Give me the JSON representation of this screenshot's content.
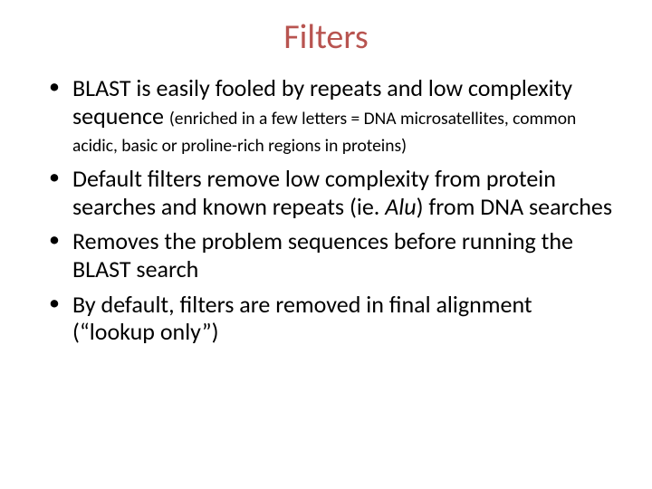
{
  "title": "Filters",
  "bullets": {
    "b1_main": "BLAST is easily fooled by repeats and low complexity sequence ",
    "b1_sub": "(enriched in a few letters = DNA microsatellites, common acidic, basic or proline-rich regions in proteins)",
    "b2_a": "Default filters remove low complexity from protein searches and known repeats (ie. ",
    "b2_i": "Alu",
    "b2_b": ") from DNA searches",
    "b3": "Removes the problem sequences before running the BLAST search",
    "b4": "By default, filters are  removed in final alignment (“lookup only”)"
  }
}
